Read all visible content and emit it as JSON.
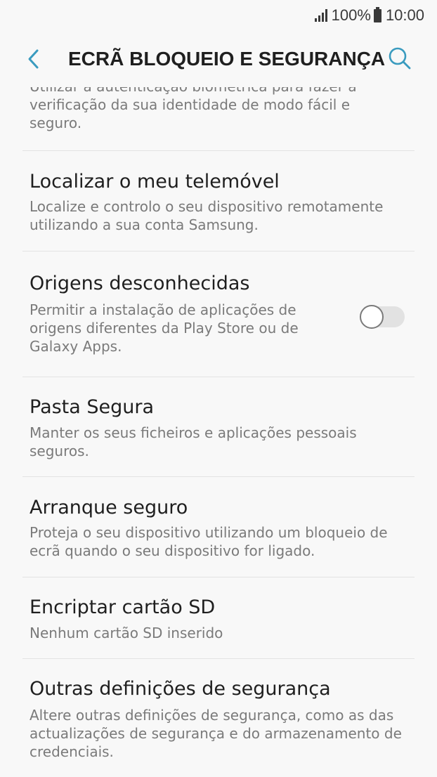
{
  "status_bar": {
    "battery": "100%",
    "time": "10:00"
  },
  "header": {
    "title": "ECRÃ BLOQUEIO E SEGURANÇA",
    "back_icon": "chevron-left-icon",
    "search_icon": "search-icon"
  },
  "partial_item": {
    "description": "Utilizar a autenticação biométrica para fazer a verificação da sua identidade de modo fácil e seguro."
  },
  "items": [
    {
      "title": "Localizar o meu telemóvel",
      "description": "Localize e controlo o seu dispositivo remotamente utilizando a sua conta Samsung."
    },
    {
      "title": "Origens desconhecidas",
      "description": "Permitir a instalação de aplicações de origens diferentes da Play Store ou de Galaxy Apps.",
      "toggle": "off"
    },
    {
      "title": "Pasta Segura",
      "description": "Manter os seus ficheiros e aplicações pessoais seguros."
    },
    {
      "title": "Arranque seguro",
      "description": "Proteja o seu dispositivo utilizando um bloqueio de ecrã quando o seu dispositivo for ligado."
    },
    {
      "title": "Encriptar cartão SD",
      "description": "Nenhum cartão SD inserido"
    },
    {
      "title": "Outras definições de segurança",
      "description": "Altere outras definições de segurança, como as das actualizações de segurança e do armazenamento de credenciais."
    }
  ],
  "colors": {
    "background": "#f8f8f8",
    "accent": "#3a9bbf",
    "title_text": "#1f1f1f",
    "secondary_text": "#7a7a7a",
    "divider": "#e3e3e3"
  }
}
